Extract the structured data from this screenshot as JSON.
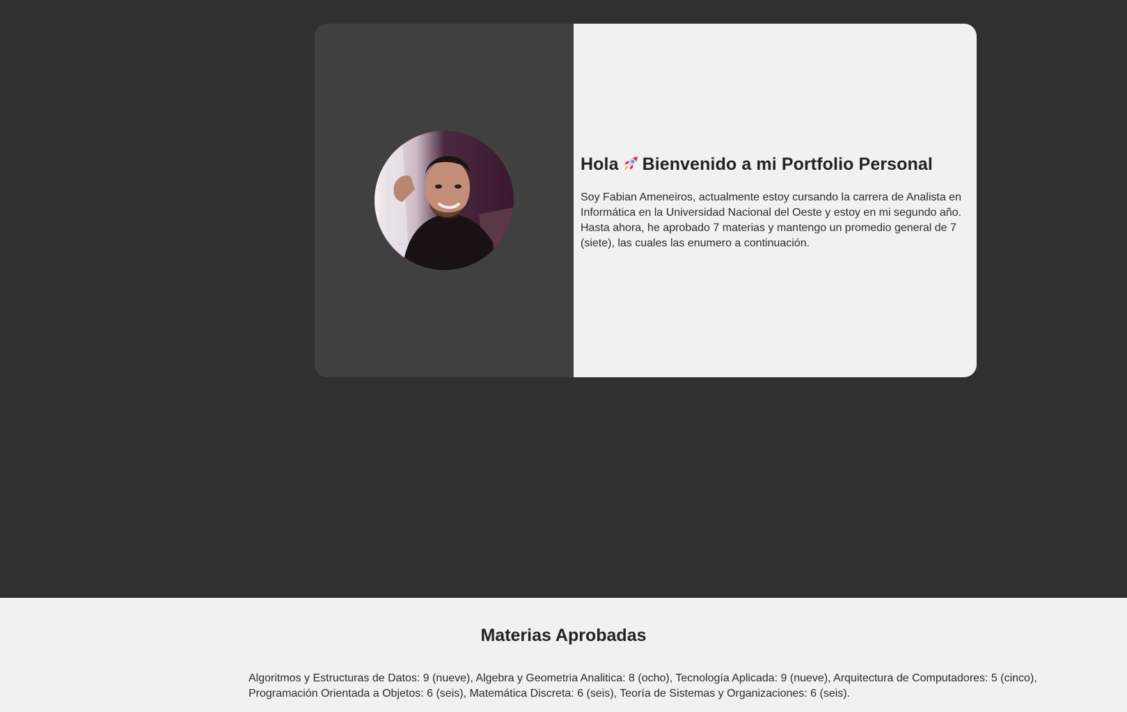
{
  "hero": {
    "title_part1": "Hola",
    "rocket_icon": "rocket-icon",
    "title_part2": "Bienvenido a mi Portfolio Personal",
    "intro": "Soy Fabian Ameneiros, actualmente estoy cursando la carrera de Analista en Informática en la Universidad Nacional del Oeste y estoy en mi segundo año. Hasta ahora, he aprobado 7 materias y mantengo un promedio general de 7 (siete), las cuales las enumero a continuación."
  },
  "subjects": {
    "title": "Materias Aprobadas",
    "list": "Algoritmos y Estructuras de Datos: 9 (nueve), Algebra y Geometria Analitica: 8 (ocho), Tecnología Aplicada: 9 (nueve), Arquitectura de Computadores: 5 (cinco), Programación Orientada a Objetos: 6 (seis), Matemática Discreta: 6 (seis), Teoría de Sistemas y Organizaciones: 6 (seis)."
  },
  "colors": {
    "page_background": "#303030",
    "card_left": "#404040",
    "card_right": "#f1f1f1",
    "text": "#222222"
  }
}
